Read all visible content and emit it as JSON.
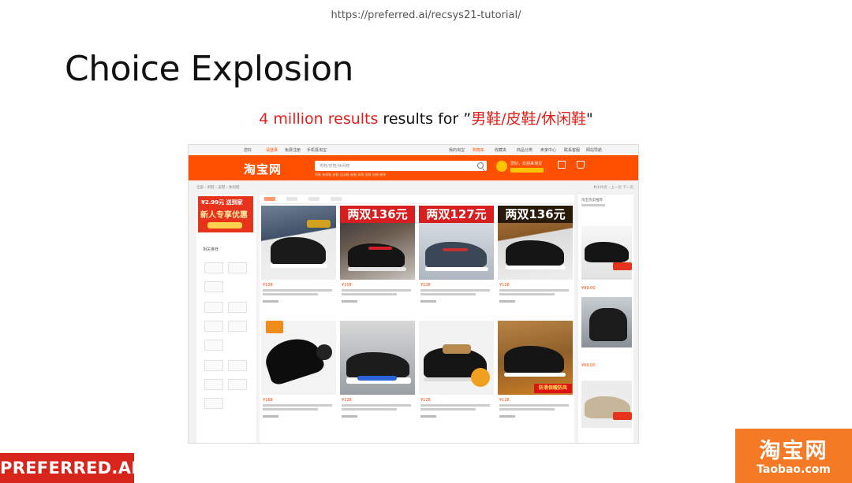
{
  "slide": {
    "url": "https://preferred.ai/recsys21-tutorial/",
    "title": "Choice Explosion",
    "subtitle_count": "4 million results",
    "subtitle_mid": " results for ”",
    "subtitle_query": "男鞋/皮鞋/休闲鞋",
    "subtitle_end": "\""
  },
  "screenshot": {
    "topbar": {
      "greeting": "您好",
      "login": "请登录",
      "register": "免费注册",
      "mobile": "手机逛淘宝",
      "my_taobao": "我的淘宝",
      "cart": "购物车",
      "favorites": "收藏夹",
      "product_category": "商品分类",
      "seller_center": "卖家中心",
      "contact": "联系客服",
      "sitemap": "网站导航"
    },
    "header": {
      "logo": "淘宝网",
      "search_placeholder": "男鞋/皮鞋/休闲鞋",
      "hot_links": "男鞋 休闲鞋 皮鞋 运动鞋 板鞋 高帮 低帮 加绒 春季",
      "user_hint": "您好，欢迎来淘宝"
    },
    "promo": {
      "line1": "¥2.99元 送到家",
      "line2": "新人专享优惠"
    },
    "left_panel_label": "相关推荐",
    "products": [
      {
        "price": "¥108",
        "banner": ""
      },
      {
        "price": "¥108",
        "banner": "两双136元"
      },
      {
        "price": "¥128",
        "banner": "两双127元"
      },
      {
        "price": "¥128",
        "banner": "两双136元"
      },
      {
        "price": "¥168",
        "banner": ""
      },
      {
        "price": "¥128",
        "banner": ""
      },
      {
        "price": "¥128",
        "banner": ""
      },
      {
        "price": "¥128",
        "banner": "防滑保暖防风"
      }
    ],
    "right_panel": {
      "title": "淘宝热卖推荐",
      "prices": [
        "¥99.00",
        "¥69.00",
        "¥79.00"
      ]
    }
  },
  "badges": {
    "preferred": "PREFERRED.AI",
    "taobao_cn": "淘宝网",
    "taobao_domain": "Taobao.com"
  },
  "colors": {
    "accent_red": "#e0201b",
    "taobao_orange": "#ff5000",
    "preferred_red": "#d7251c",
    "taobao_badge": "#f47a25"
  }
}
